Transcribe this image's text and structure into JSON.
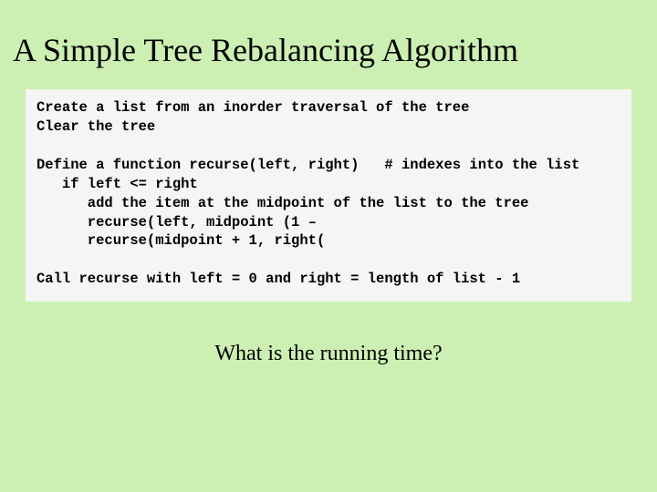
{
  "title": "A Simple Tree Rebalancing Algorithm",
  "code": {
    "l1": "Create a list from an inorder traversal of the tree",
    "l2": "Clear the tree",
    "blank1": "",
    "l3a": "Define a function recurse(left, right)",
    "l3b": "   # indexes into the list",
    "l4": "   if left <= right",
    "l5": "      add the item at the midpoint of the list to the tree",
    "l6": "      recurse(left, midpoint (1 –",
    "l7": "      recurse(midpoint + 1, right(",
    "blank2": "",
    "l8": "Call recurse with left = 0 and right = length of list - 1"
  },
  "question": "What is the running time?"
}
